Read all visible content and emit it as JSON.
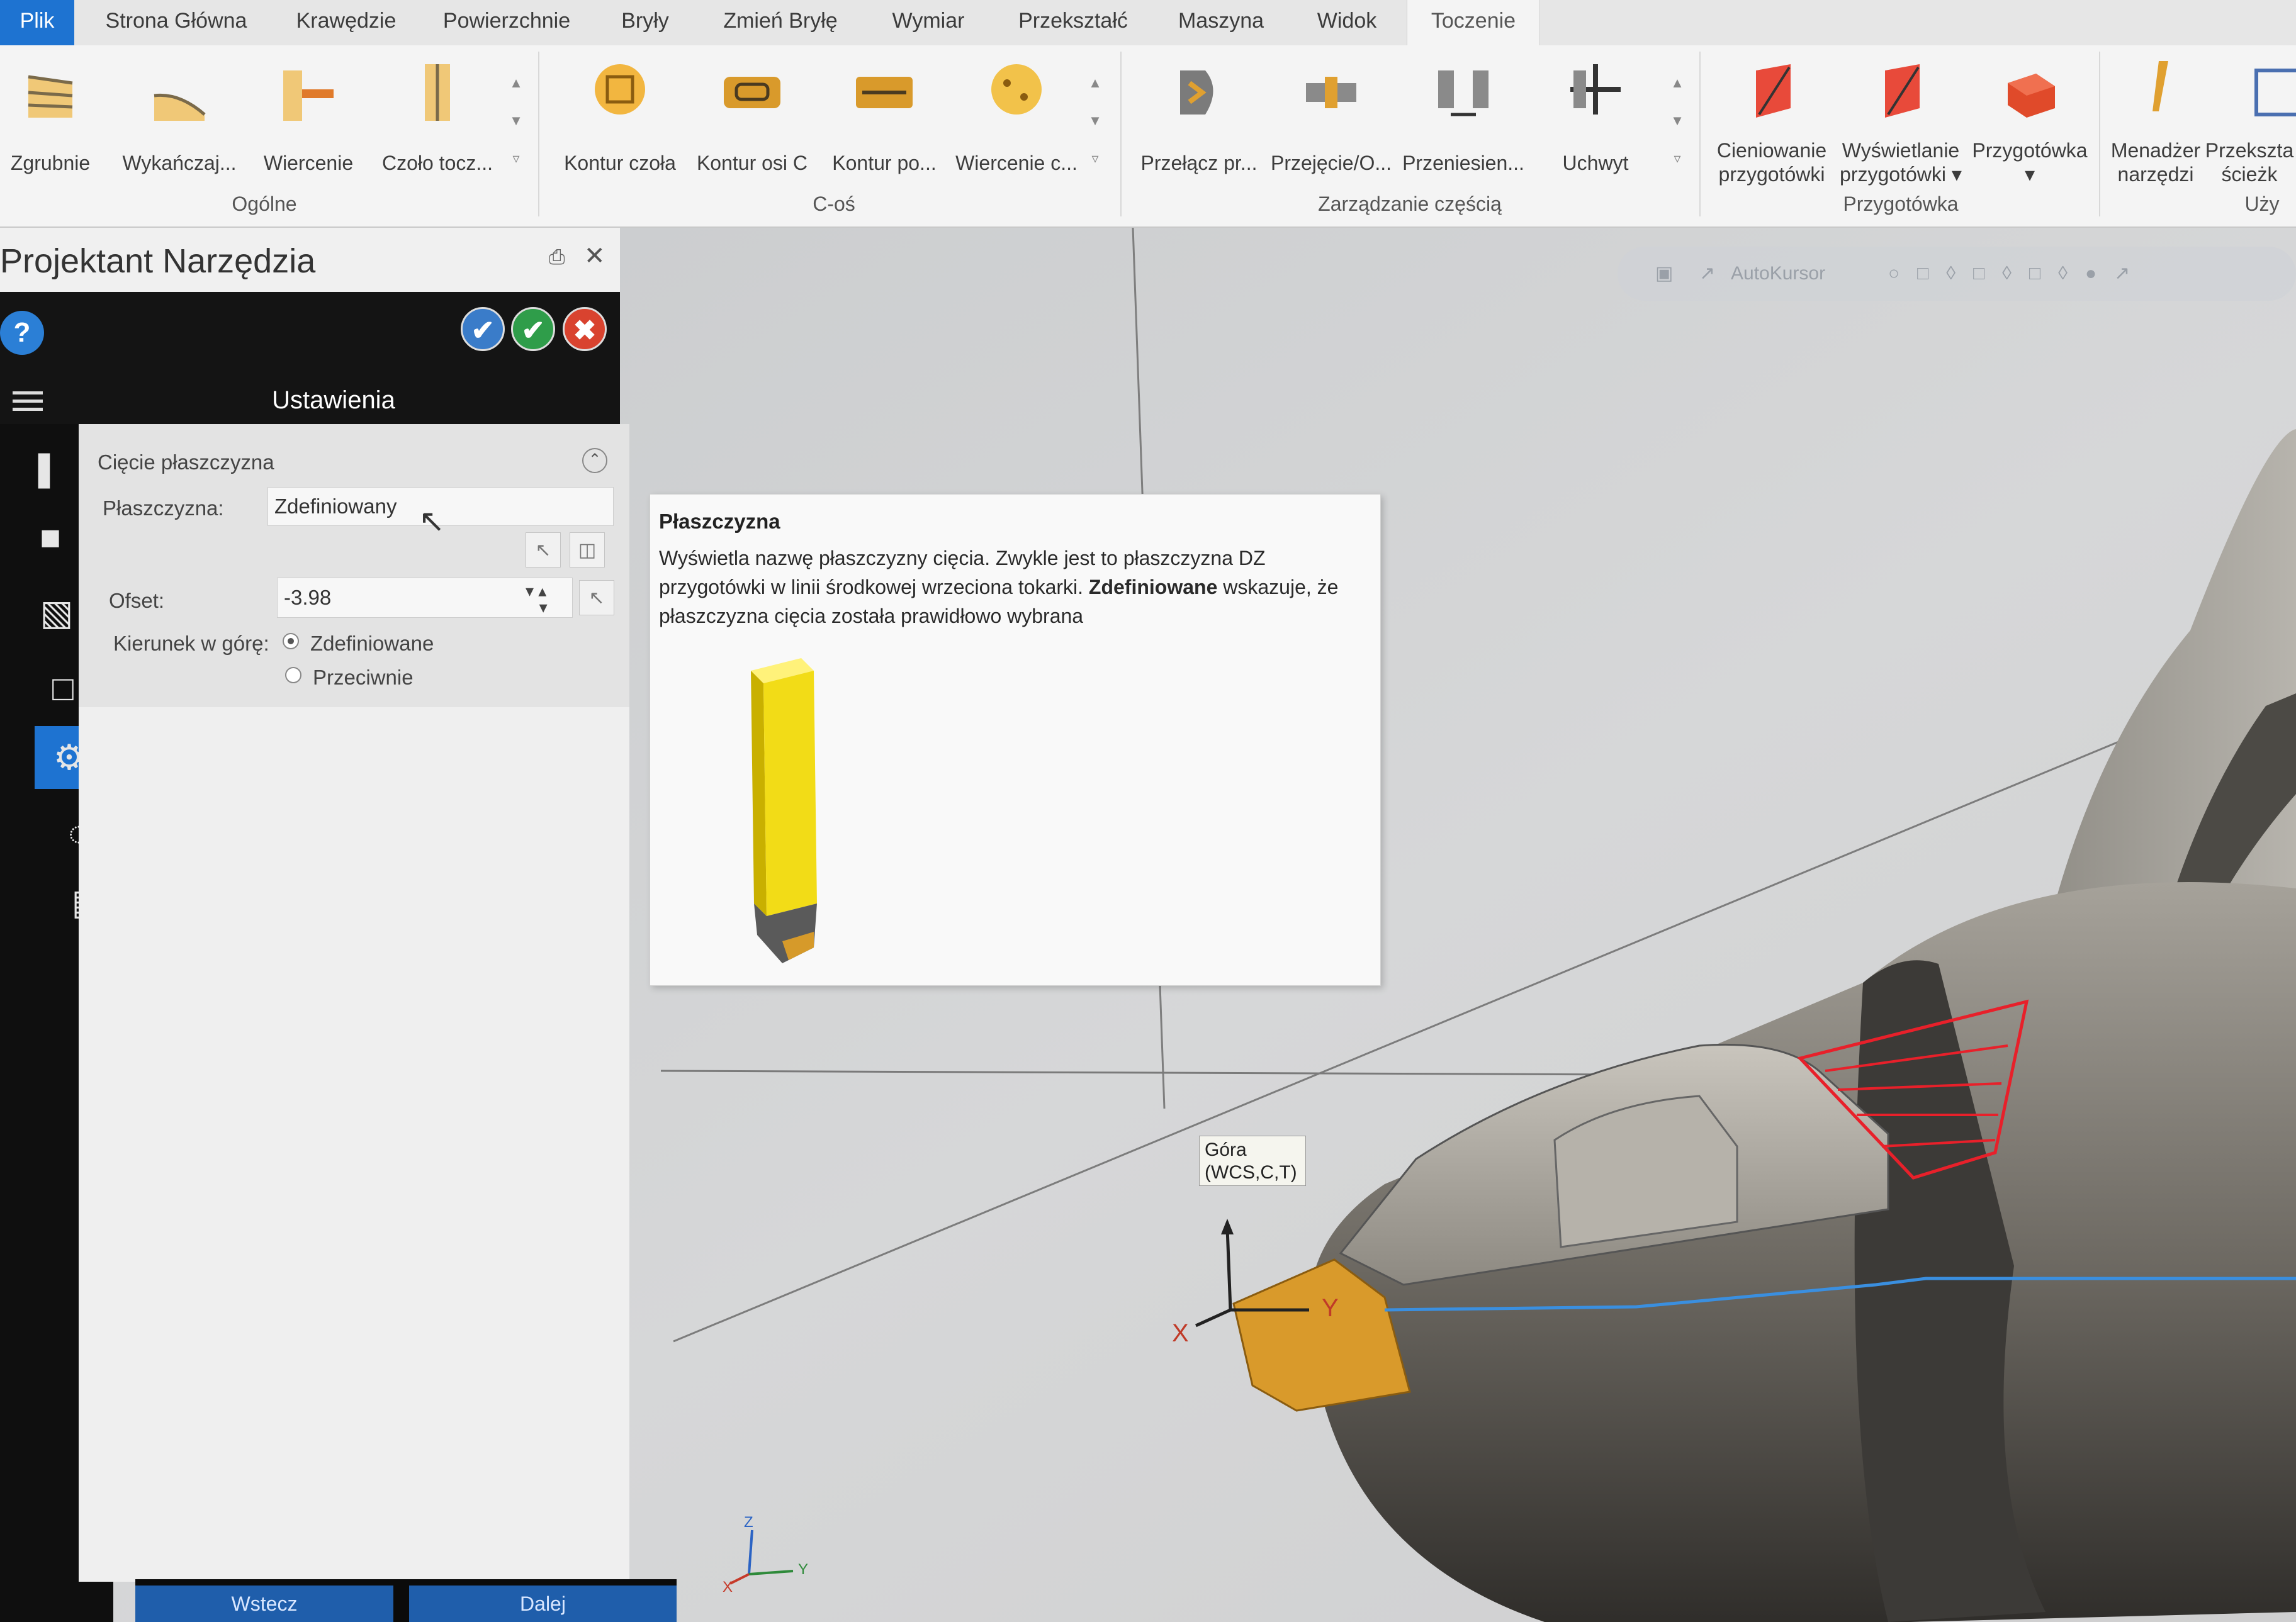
{
  "ribbon_tabs": [
    "Plik",
    "Strona Główna",
    "Krawędzie",
    "Powierzchnie",
    "Bryły",
    "Zmień Bryłę",
    "Wymiar",
    "Przekształć",
    "Maszyna",
    "Widok",
    "Toczenie"
  ],
  "ribbon": {
    "general": {
      "label": "Ogólne",
      "buttons": [
        "Zgrubnie",
        "Wykańczaj...",
        "Wiercenie",
        "Czoło tocz..."
      ]
    },
    "c_axis": {
      "label": "C-oś",
      "buttons": [
        "Kontur czoła",
        "Kontur osi C",
        "Kontur po...",
        "Wiercenie c..."
      ]
    },
    "part_management": {
      "label": "Zarządzanie częścią",
      "buttons": [
        "Przełącz pr...",
        "Przejęcie/O...",
        "Przeniesien...",
        "Uchwyt"
      ]
    },
    "stock": {
      "label": "Przygotówka",
      "buttons": [
        {
          "line1": "Cieniowanie",
          "line2": "przygotówki"
        },
        {
          "line1": "Wyświetlanie",
          "line2": "przygotówki"
        },
        {
          "line1": "Przygotówka",
          "line2": ""
        }
      ]
    },
    "utility": {
      "label": "Uży",
      "buttons": [
        {
          "line1": "Menadżer",
          "line2": "narzędzi"
        },
        {
          "line1": "Przekszta",
          "line2": "ścieżk"
        }
      ]
    }
  },
  "panel": {
    "title": "Projektant Narzędzia",
    "header": "Ustawienia",
    "section": "Cięcie płaszczyzna",
    "plane_label": "Płaszczyzna:",
    "plane_value": "Zdefiniowany",
    "offset_label": "Ofset:",
    "offset_value": "-3.98",
    "direction_label": "Kierunek w górę:",
    "direction_options": [
      "Zdefiniowane",
      "Przeciwnie"
    ],
    "direction_selected": "Zdefiniowane",
    "back_button": "Wstecz",
    "next_button": "Dalej"
  },
  "tooltip": {
    "title": "Płaszczyzna",
    "text_part1": "Wyświetla nazwę płaszczyzny cięcia. Zwykle jest to płaszczyzna DZ przygotówki w linii środkowej wrzeciona tokarki.",
    "bold": "Zdefiniowane",
    "text_part2": "wskazuje, że płaszczyzna cięcia została prawidłowo wybrana"
  },
  "viewport": {
    "view_label_line1": "Góra",
    "view_label_line2": "(WCS,C,T)",
    "autokursor": "AutoKursor",
    "axis_labels": [
      "X",
      "Y"
    ],
    "triad_labels": [
      "Z",
      "Y",
      "X"
    ]
  },
  "colors": {
    "accent": "#1e73d1",
    "tool_yellow": "#f2dc17",
    "highlight_red": "#e8202a",
    "path_blue": "#3a8fe0"
  }
}
